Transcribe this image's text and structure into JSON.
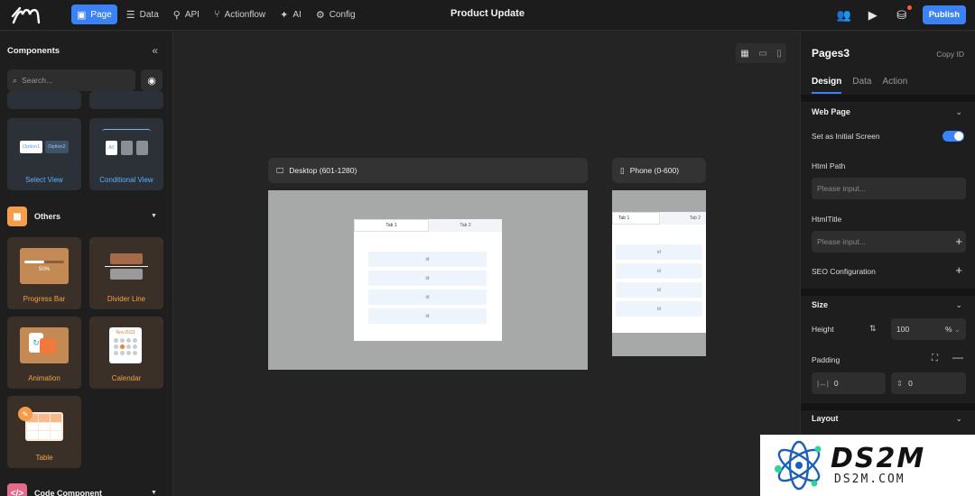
{
  "topbar": {
    "nav": [
      {
        "label": "Page",
        "icon": "page-icon",
        "active": true
      },
      {
        "label": "Data",
        "icon": "database-icon",
        "active": false
      },
      {
        "label": "API",
        "icon": "api-icon",
        "active": false
      },
      {
        "label": "Actionflow",
        "icon": "flow-icon",
        "active": false
      },
      {
        "label": "AI",
        "icon": "ai-icon",
        "active": false
      },
      {
        "label": "Config",
        "icon": "gear-icon",
        "active": false
      }
    ],
    "title": "Product Update",
    "publish_label": "Publish"
  },
  "left_panel": {
    "heading": "Components",
    "search_placeholder": "Search...",
    "cards_top": [
      {
        "label": "Select View",
        "opt1": "Option1",
        "opt2": "Option2"
      },
      {
        "label": "Conditional View",
        "tag": "All"
      }
    ],
    "section_others": "Others",
    "cards_others": [
      {
        "label": "Progress Bar",
        "progress": "50%"
      },
      {
        "label": "Divider Line"
      },
      {
        "label": "Animation"
      },
      {
        "label": "Calendar",
        "month": "Nov.2023"
      },
      {
        "label": "Table"
      }
    ],
    "section_code": "Code Component"
  },
  "canvas": {
    "desktop_label": "Desktop (601-1280)",
    "phone_label": "Phone (0-600)",
    "tab1": "Tab 1",
    "tab2": "Tab 2",
    "row_text": "id"
  },
  "right_panel": {
    "title": "Pages3",
    "copy_id": "Copy ID",
    "tabs": [
      "Design",
      "Data",
      "Action"
    ],
    "web_page_section": "Web Page",
    "initial_screen_label": "Set as Initial Screen",
    "html_path_label": "Html Path",
    "html_path_placeholder": "Please input...",
    "html_title_label": "HtmlTitle",
    "html_title_placeholder": "Please input...",
    "seo_label": "SEO Configuration",
    "size_section": "Size",
    "height_label": "Height",
    "height_value": "100",
    "height_unit": "%",
    "padding_label": "Padding",
    "padding_h": "0",
    "padding_v": "0",
    "layout_section": "Layout"
  },
  "watermark": {
    "big": "DS2M",
    "small": "DS2M.COM"
  }
}
